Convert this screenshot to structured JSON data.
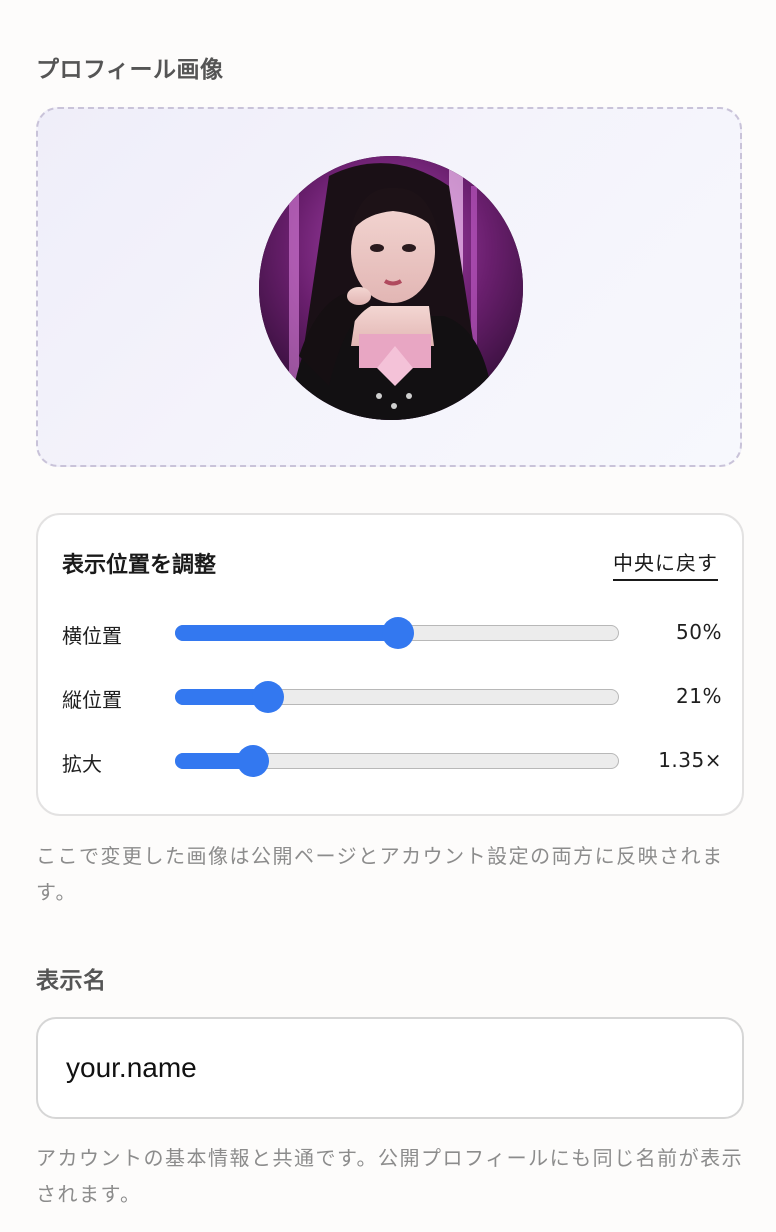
{
  "profile_image": {
    "label": "プロフィール画像",
    "avatar_alt": "profile-photo"
  },
  "adjust": {
    "title": "表示位置を調整",
    "reset_label": "中央に戻す",
    "sliders": [
      {
        "label": "横位置",
        "value_text": "50%",
        "fraction": 0.5
      },
      {
        "label": "縦位置",
        "value_text": "21%",
        "fraction": 0.21
      },
      {
        "label": "拡大",
        "value_text": "1.35×",
        "fraction": 0.175
      }
    ]
  },
  "help_image": "ここで変更した画像は公開ページとアカウント設定の両方に反映されます。",
  "display_name": {
    "label": "表示名",
    "value": "your.name"
  },
  "help_name": "アカウントの基本情報と共通です。公開プロフィールにも同じ名前が表示されます。",
  "colors": {
    "accent": "#3378f0",
    "track": "#ececec",
    "muted_text": "#8c8c8c"
  }
}
